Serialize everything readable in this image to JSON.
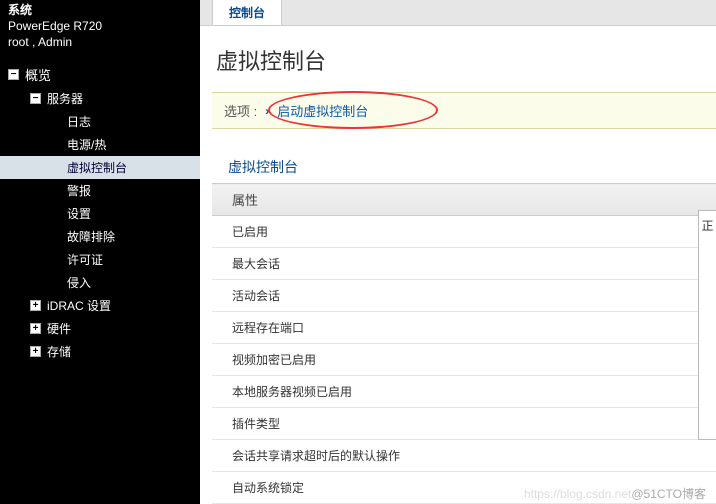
{
  "system": {
    "label": "系统",
    "model": "PowerEdge R720",
    "user_line": "root , Admin"
  },
  "tree": {
    "overview": "概览",
    "server": "服务器",
    "items": {
      "log": "日志",
      "power": "电源/热",
      "vconsole": "虚拟控制台",
      "alert": "警报",
      "settings": "设置",
      "trouble": "故障排除",
      "license": "许可证",
      "intrusion": "侵入"
    },
    "idrac": "iDRAC 设置",
    "hardware": "硬件",
    "storage": "存储"
  },
  "main": {
    "tab": "控制台",
    "title": "虚拟控制台",
    "options_label": "选项 :",
    "launch_link": "启动虚拟控制台",
    "section": "虚拟控制台",
    "column_header": "属性",
    "rows": [
      "已启用",
      "最大会话",
      "活动会话",
      "远程存在端口",
      "视频加密已启用",
      "本地服务器视频已启用",
      "插件类型",
      "会话共享请求超时后的默认操作",
      "自动系统锁定"
    ]
  },
  "right_panel": "正",
  "watermark": {
    "pre": "https://blog.csdn.net",
    "suf": "@51CTO博客"
  }
}
